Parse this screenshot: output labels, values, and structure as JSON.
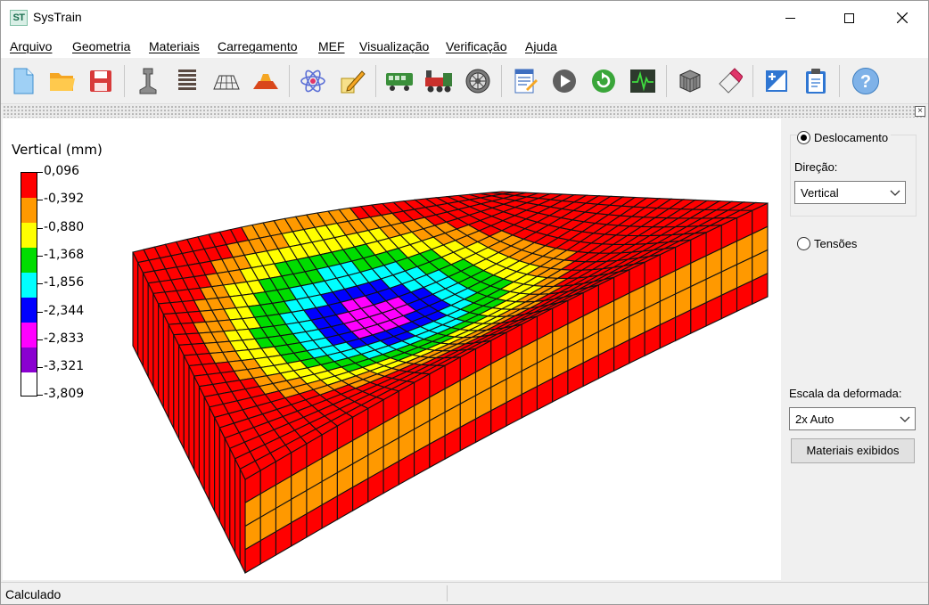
{
  "window": {
    "icon_text": "ST",
    "title": "SysTrain"
  },
  "menu": {
    "items": [
      "Arquivo",
      "Geometria",
      "Materiais",
      "Carregamento",
      "MEF",
      "Visualização",
      "Verificação",
      "Ajuda"
    ]
  },
  "toolbar": {
    "icons": [
      "new-file-icon",
      "open-folder-icon",
      "save-icon",
      "rail-icon",
      "sleepers-icon",
      "ballast-icon",
      "embankment-icon",
      "atom-icon",
      "pencil-edit-icon",
      "wagon-icon",
      "locomotive-icon",
      "wheel-icon",
      "report-icon",
      "run-icon",
      "refresh-icon",
      "signal-icon",
      "mesh-cube-icon",
      "eraser-icon",
      "add-chart-icon",
      "clipboard-icon",
      "help-icon"
    ]
  },
  "legend": {
    "title": "Vertical (mm)",
    "labels": [
      "0,096",
      "-0,392",
      "-0,880",
      "-1,368",
      "-1,856",
      "-2,344",
      "-2,833",
      "-3,321",
      "-3,809"
    ],
    "colors": [
      "#ff0000",
      "#ff9900",
      "#ffff00",
      "#00dd00",
      "#00ffff",
      "#0000ff",
      "#ff00ff",
      "#8a00d0"
    ]
  },
  "panel": {
    "displacement_label": "Deslocamento",
    "displacement_selected": true,
    "direction_label": "Direção:",
    "direction_value": "Vertical",
    "stress_label": "Tensões",
    "stress_selected": false,
    "scale_label": "Escala da deformada:",
    "scale_value": "2x Auto",
    "materials_button": "Materiais exibidos"
  },
  "status": {
    "text": "Calculado"
  }
}
